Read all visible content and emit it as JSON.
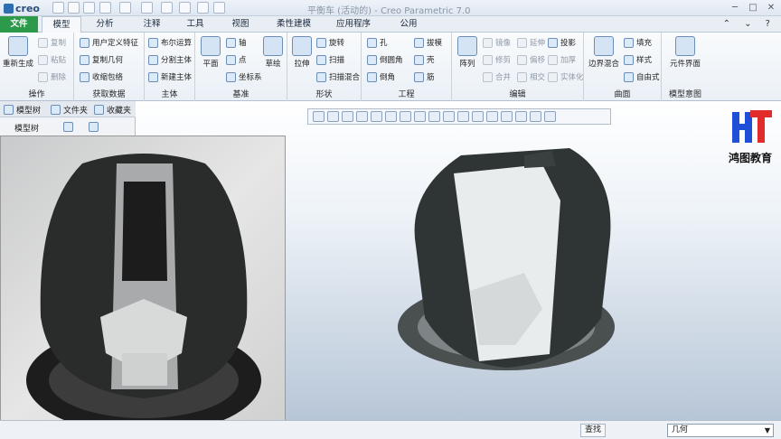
{
  "app": {
    "logo_text": "creo",
    "window_title": "平衡车 (活动的) - Creo Parametric 7.0"
  },
  "window_controls": {
    "minimize": "─",
    "maximize": "□",
    "close": "✕"
  },
  "menu_tabs": [
    {
      "label": "文件"
    },
    {
      "label": "模型"
    },
    {
      "label": "分析"
    },
    {
      "label": "注释"
    },
    {
      "label": "工具"
    },
    {
      "label": "视图"
    },
    {
      "label": "柔性建模"
    },
    {
      "label": "应用程序"
    },
    {
      "label": "公用"
    }
  ],
  "help_icons": "⌃ ⌄ ?",
  "ribbon": {
    "operations": {
      "label": "操作",
      "regen": "重新生成",
      "copy": "复制",
      "paste": "粘贴",
      "delete": "删除"
    },
    "get_data": {
      "label": "获取数据",
      "udf": "用户定义特征",
      "copy_geom": "复制几何",
      "shrinkwrap": "收缩包络"
    },
    "body": {
      "label": "主体",
      "boolean": "布尔运算",
      "split": "分割主体",
      "new": "新建主体"
    },
    "datum": {
      "label": "基准",
      "plane": "平面",
      "axis": "轴",
      "point": "点",
      "csys": "坐标系",
      "sketch": "草绘"
    },
    "shapes": {
      "label": "形状",
      "extrude": "拉伸",
      "revolve": "旋转",
      "sweep": "扫描",
      "sweep_blend": "扫描混合"
    },
    "engineering": {
      "label": "工程",
      "hole": "孔",
      "round": "倒圆角",
      "chamfer": "倒角",
      "draft": "拔模",
      "shell": "壳",
      "rib": "筋"
    },
    "editing": {
      "label": "编辑",
      "pattern": "阵列",
      "mirror": "镜像",
      "extend": "延伸",
      "project": "投影",
      "trim": "修剪",
      "offset": "偏移",
      "thicken": "加厚",
      "merge": "合并",
      "intersect": "相交",
      "solidify": "实体化"
    },
    "surfaces": {
      "label": "曲面",
      "boundary": "边界混合",
      "fill": "填充",
      "style": "样式",
      "freestyle": "自由式"
    },
    "intent": {
      "label": "模型意图",
      "component": "元件界面"
    }
  },
  "left_panel": {
    "tab_tree": "模型树",
    "tab_files": "文件夹",
    "tab_fav": "收藏夹",
    "header": "模型树",
    "filter_icon": "▽"
  },
  "brand": {
    "logo_text": "HT",
    "name": "鸿图教育"
  },
  "status_bar": {
    "find_icon": "查找",
    "filter_value": "几何"
  }
}
